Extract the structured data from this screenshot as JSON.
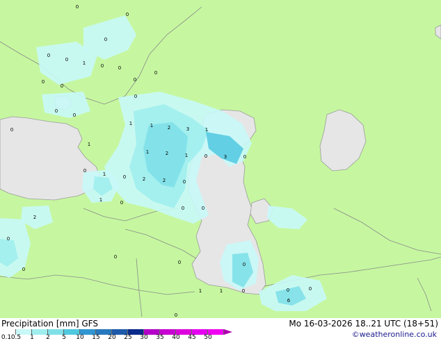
{
  "map": {
    "precip_labels": [
      "0",
      "0",
      "0",
      "0",
      "1",
      "0",
      "0",
      "0",
      "0",
      "0",
      "0",
      "0",
      "0",
      "0",
      "0",
      "0",
      "1",
      "1",
      "2",
      "3",
      "1",
      "1",
      "1",
      "2",
      "1",
      "0",
      "3",
      "0",
      "0",
      "1",
      "2",
      "2",
      "0",
      "0",
      "1",
      "0",
      "2",
      "0",
      "0",
      "0",
      "0",
      "0",
      "0",
      "0",
      "1",
      "1",
      "0",
      "0",
      "0",
      "6",
      "0",
      "0",
      "0"
    ]
  },
  "legend": {
    "title": "Precipitation [mm]  GFS",
    "datetime": "Mo 16-03-2026 18..21 UTC (18+51)",
    "credit": "©weatheronline.co.uk",
    "scale_labels": [
      "0.1",
      "0.5",
      "1",
      "2",
      "5",
      "10",
      "15",
      "20",
      "25",
      "30",
      "35",
      "40",
      "45",
      "50"
    ],
    "scale_colors": [
      "#ffffff",
      "#c8f8f8",
      "#a0eeee",
      "#80e0e8",
      "#50c8e0",
      "#3296d2",
      "#2878be",
      "#1e5aaa",
      "#0a2a8c",
      "#b400c8",
      "#c800d2",
      "#dc00dc",
      "#e600f0",
      "#f000f0"
    ]
  }
}
